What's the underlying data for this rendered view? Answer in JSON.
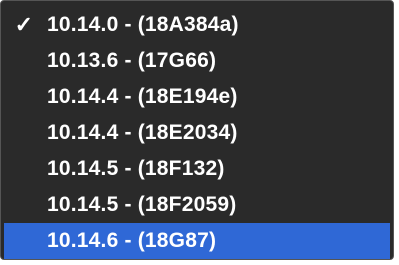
{
  "menu": {
    "items": [
      {
        "label": "10.14.0 - (18A384a)",
        "checked": true,
        "highlighted": false,
        "check_icon": "✓"
      },
      {
        "label": "10.13.6 - (17G66)",
        "checked": false,
        "highlighted": false
      },
      {
        "label": "10.14.4 - (18E194e)",
        "checked": false,
        "highlighted": false
      },
      {
        "label": "10.14.4 - (18E2034)",
        "checked": false,
        "highlighted": false
      },
      {
        "label": "10.14.5 - (18F132)",
        "checked": false,
        "highlighted": false
      },
      {
        "label": "10.14.5 - (18F2059)",
        "checked": false,
        "highlighted": false
      },
      {
        "label": "10.14.6 - (18G87)",
        "checked": false,
        "highlighted": true
      }
    ]
  },
  "colors": {
    "background": "#2a2a2a",
    "text": "#ffffff",
    "highlight": "#2f68d6"
  },
  "icons": {
    "checkmark": "checkmark-icon"
  }
}
